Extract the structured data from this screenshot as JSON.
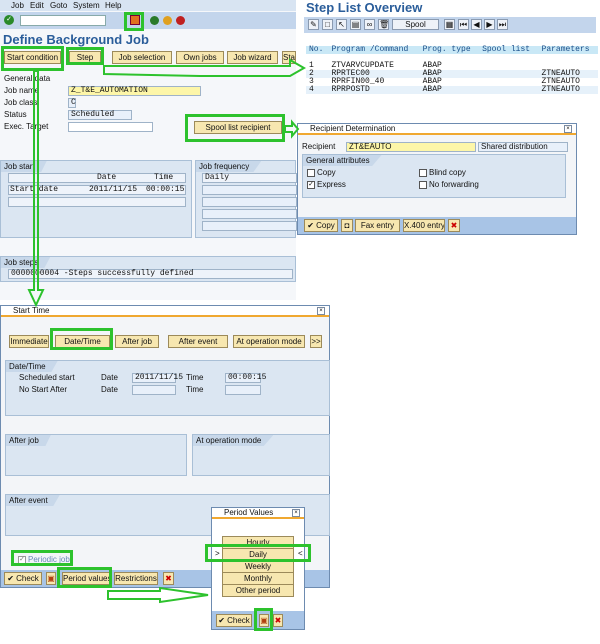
{
  "main": {
    "menu": [
      "Job",
      "Edit",
      "Goto",
      "System",
      "Help"
    ],
    "title": "Define Background Job",
    "buttons": {
      "start_condition": "Start condition",
      "step": "Step",
      "job_selection": "Job selection",
      "own_jobs": "Own jobs",
      "job_wizard": "Job wizard",
      "standard": "Sta"
    },
    "general_data": "General data",
    "job_name_label": "Job name",
    "job_name": "Z_T&E_AUTOMATION",
    "job_class_label": "Job class",
    "job_class": "C",
    "status_label": "Status",
    "status": "Scheduled",
    "exec_target_label": "Exec. Target",
    "exec_target": "",
    "spool_button": "Spool list recipient",
    "job_start": {
      "title": "Job start",
      "col_date": "Date",
      "col_time": "Time",
      "row_label": "Start date",
      "date": "2011/11/15",
      "time": "00:00:15"
    },
    "job_frequency": {
      "title": "Job frequency",
      "value": "Daily"
    },
    "job_steps": {
      "title": "Job steps",
      "value": "0000000004 -Steps successfully defined"
    }
  },
  "step_list": {
    "title": "Step List Overview",
    "spool_label": "Spool",
    "headers": [
      "No.",
      "Program /Command",
      "Prog. type",
      "Spool list",
      "Parameters"
    ],
    "rows": [
      [
        "1",
        "ZTVARVCUPDATE",
        "ABAP",
        "",
        ""
      ],
      [
        "2",
        "RPRTEC00",
        "ABAP",
        "",
        "ZTNEAUTO"
      ],
      [
        "3",
        "RPRFIN00_40",
        "ABAP",
        "",
        "ZTNEAUTO"
      ],
      [
        "4",
        "RPRPOSTD",
        "ABAP",
        "",
        "ZTNEAUTO"
      ]
    ]
  },
  "recipient": {
    "title": "Recipient Determination",
    "recipient_label": "Recipient",
    "recipient_value": "ZT&EAUTO",
    "shared": "Shared distribution",
    "attributes_title": "General attributes",
    "copy": "Copy",
    "blind_copy": "Blind copy",
    "express": "Express",
    "no_forwarding": "No forwarding",
    "express_checked": true,
    "buttons": {
      "copy": "Copy",
      "fax": "Fax entry",
      "x400": "X.400 entry"
    }
  },
  "start_time": {
    "title": "Start Time",
    "buttons": {
      "immediate": "Immediate",
      "datetime": "Date/Time",
      "after_job": "After job",
      "after_event": "After event",
      "op_mode": "At operation mode",
      "more": ">>"
    },
    "datetime_title": "Date/Time",
    "scheduled_start": "Scheduled start",
    "no_start_after": "No Start After",
    "date_label": "Date",
    "time_label": "Time",
    "start_date": "2011/11/15",
    "start_time": "00:00:15",
    "after_job_title": "After job",
    "op_mode_title": "At operation mode",
    "after_event_title": "After event",
    "periodic_job": "Periodic job",
    "periodic_checked": true,
    "footer": {
      "check": "Check",
      "period_values": "Period values",
      "restrictions": "Restrictions"
    }
  },
  "period_values": {
    "title": "Period Values",
    "options": [
      "Hourly",
      "Daily",
      "Weekly",
      "Monthly",
      "Other period"
    ],
    "selected": "Daily",
    "marker_left": ">",
    "marker_right": "<",
    "check": "Check"
  },
  "colors": {
    "highlight": "#2dc22d",
    "button": "#f7e7b0",
    "panel": "#dbe6f2",
    "title_blue": "#2a5d9a"
  }
}
